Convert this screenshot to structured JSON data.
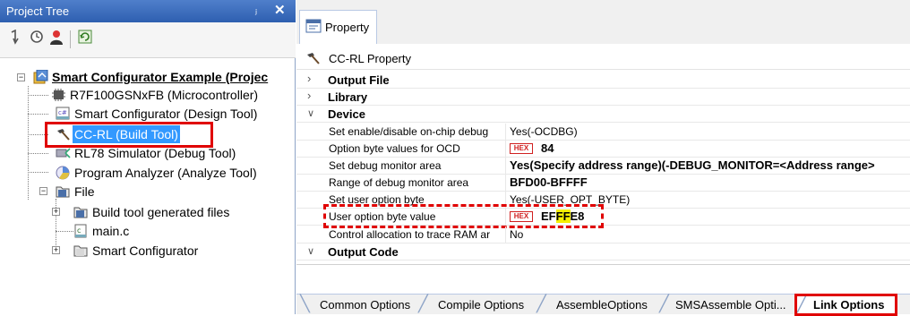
{
  "project_tree": {
    "title": "Project Tree",
    "pin_glyph": "ⱼ",
    "close_glyph": "✕",
    "nodes": [
      {
        "label": "Smart Configurator Example (Projec",
        "icon": "project-icon"
      },
      {
        "label": "R7F100GSNxFB (Microcontroller)",
        "icon": "chip-icon"
      },
      {
        "label": "Smart Configurator (Design Tool)",
        "icon": "design-tool-icon"
      },
      {
        "label": "CC-RL (Build Tool)",
        "icon": "hammer-icon"
      },
      {
        "label": "RL78 Simulator (Debug Tool)",
        "icon": "debug-tool-icon"
      },
      {
        "label": "Program Analyzer (Analyze Tool)",
        "icon": "analyzer-icon"
      },
      {
        "label": "File",
        "icon": "folder-icon"
      },
      {
        "label": "Build tool generated files",
        "icon": "folder-icon"
      },
      {
        "label": "main.c",
        "icon": "c-file-icon"
      },
      {
        "label": "Smart Configurator",
        "icon": "folder-icon"
      }
    ]
  },
  "property": {
    "tab_label": "Property",
    "header": "CC-RL Property",
    "categories": {
      "output_file": "Output File",
      "library": "Library",
      "device": "Device",
      "output_code": "Output Code"
    },
    "rows": [
      {
        "name": "Set enable/disable on-chip debug",
        "value": "Yes(-OCDBG)"
      },
      {
        "name": "Option byte values for OCD",
        "value": "84"
      },
      {
        "name": "Set debug monitor area",
        "value": "Yes(Specify address range)(-DEBUG_MONITOR=<Address range>"
      },
      {
        "name": "Range of debug monitor area",
        "value": "BFD00-BFFFF"
      },
      {
        "name": "Set user option byte",
        "value": "Yes(-USER_OPT_BYTE)"
      },
      {
        "name": "User option byte value",
        "value_prefix": "EF",
        "value_highlight": "FF",
        "value_suffix": "E8"
      },
      {
        "name": "Control allocation to trace RAM ar",
        "value": "No"
      }
    ],
    "hex_badge": "HEX"
  },
  "bottom_tabs": [
    {
      "label": "Common Options"
    },
    {
      "label": "Compile Options"
    },
    {
      "label": "AssembleOptions"
    },
    {
      "label": "SMSAssemble Opti..."
    },
    {
      "label": "Link Options"
    }
  ],
  "colors": {
    "accent_red": "#e00000",
    "selection_blue": "#3399ff",
    "highlight_yellow": "#f5f000",
    "title_blue": "#3a6cc0"
  }
}
